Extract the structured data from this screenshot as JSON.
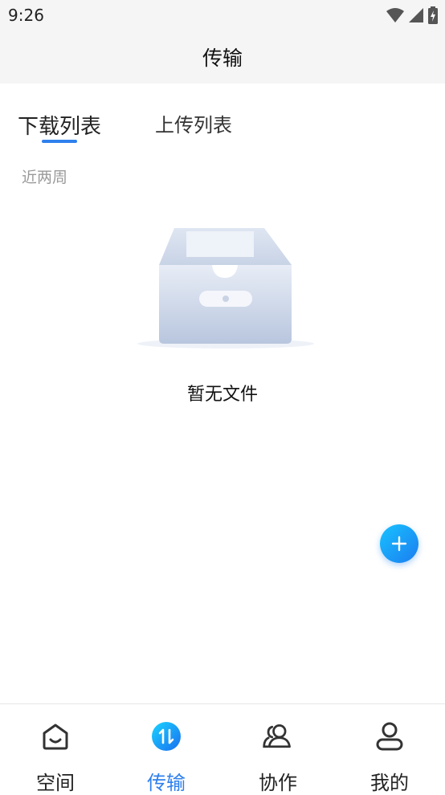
{
  "status": {
    "time": "9:26"
  },
  "header": {
    "title": "传输"
  },
  "tabs": [
    {
      "label": "下载列表",
      "active": true
    },
    {
      "label": "上传列表",
      "active": false
    }
  ],
  "section": {
    "label": "近两周"
  },
  "empty": {
    "text": "暂无文件"
  },
  "fab": {
    "icon": "plus-icon"
  },
  "bottom_nav": [
    {
      "label": "空间",
      "icon": "home-icon",
      "active": false
    },
    {
      "label": "传输",
      "icon": "transfer-icon",
      "active": true
    },
    {
      "label": "协作",
      "icon": "collaboration-icon",
      "active": false
    },
    {
      "label": "我的",
      "icon": "profile-icon",
      "active": false
    }
  ],
  "colors": {
    "accent": "#2f80ed",
    "fab": "#1a9af5",
    "background": "#ffffff",
    "header_bg": "#f5f5f5"
  }
}
